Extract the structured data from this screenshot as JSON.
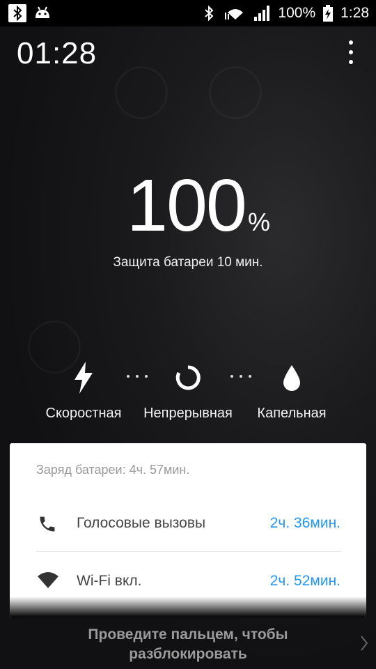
{
  "status_bar": {
    "icons_left": [
      "bluetooth-icon",
      "android-icon"
    ],
    "icons_right": [
      "bluetooth-icon",
      "wifi-data-icon",
      "signal-icon",
      "battery-charging-icon"
    ],
    "battery_text": "100%",
    "time": "1:28"
  },
  "lockscreen": {
    "clock": "01:28",
    "battery_percent": "100",
    "percent_sign": "%",
    "protection_text": "Защита батареи 10 мин."
  },
  "charging_modes": [
    {
      "label": "Скоростная",
      "icon": "lightning-icon"
    },
    {
      "label": "Непрерывная",
      "icon": "circle-refresh-icon"
    },
    {
      "label": "Капельная",
      "icon": "drop-icon"
    }
  ],
  "card": {
    "header": "Заряд батареи: 4ч. 57мин.",
    "rows": [
      {
        "label": "Голосовые вызовы",
        "value": "2ч. 36мин.",
        "icon": "phone-icon"
      },
      {
        "label": "Wi-Fi вкл.",
        "value": "2ч. 52мин.",
        "icon": "wifi-icon"
      }
    ]
  },
  "swipe_text_line1": "Проведите пальцем, чтобы",
  "swipe_text_line2": "разблокировать",
  "colors": {
    "accent": "#2196f3",
    "card_bg": "#ffffff",
    "status_bar": "#000000"
  }
}
